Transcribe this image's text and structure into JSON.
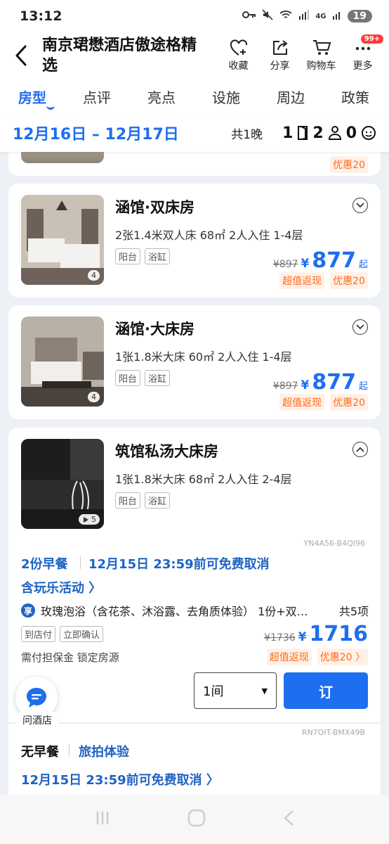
{
  "status": {
    "time": "13:12",
    "network": "4G",
    "battery": "19"
  },
  "header": {
    "title": "南京珺懋酒店傲途格精选",
    "actions": [
      {
        "label": "收藏",
        "icon": "heart-plus-icon"
      },
      {
        "label": "分享",
        "icon": "share-icon"
      },
      {
        "label": "购物车",
        "icon": "cart-icon"
      },
      {
        "label": "更多",
        "icon": "more-icon",
        "badge": "99+"
      }
    ]
  },
  "tabs": [
    "房型",
    "点评",
    "亮点",
    "设施",
    "周边",
    "政策"
  ],
  "datebar": {
    "dates": "12月16日 – 12月17日",
    "nights": "共1晚",
    "rooms": "1",
    "adults": "2",
    "children": "0"
  },
  "partial_card": {
    "promo": "优惠20"
  },
  "rooms": [
    {
      "name": "涵馆·双床房",
      "info": "2张1.4米双人床  68㎡  2人入住  1-4层",
      "tags": [
        "阳台",
        "浴缸"
      ],
      "original_price": "¥897",
      "currency": "¥",
      "price": "877",
      "price_suffix": "起",
      "promos": [
        "超值返现",
        "优惠20"
      ],
      "photo_count": "4"
    },
    {
      "name": "涵馆·大床房",
      "info": "1张1.8米大床  60㎡  2人入住  1-4层",
      "tags": [
        "阳台",
        "浴缸"
      ],
      "original_price": "¥897",
      "currency": "¥",
      "price": "877",
      "price_suffix": "起",
      "promos": [
        "超值返现",
        "优惠20"
      ],
      "photo_count": "4"
    },
    {
      "name": "筑馆私汤大床房",
      "info": "1张1.8米大床  68㎡  2人入住  2-4层",
      "tags": [
        "阳台",
        "浴缸"
      ],
      "photo_count": "5"
    }
  ],
  "package1": {
    "code": "YN4A56-B4QI96",
    "breakfast": "2份早餐",
    "cancel": "12月15日 23:59前可免费取消",
    "activity": "含玩乐活动 〉",
    "xiang_icon": "享",
    "xiang_text": "玫瑰泡浴（含花茶、沐浴露、去角质体验） 1份+双…",
    "xiang_count": "共5项",
    "tags": [
      "到店付",
      "立即确认"
    ],
    "deposit": "需付担保金 锁定房源",
    "original_price": "¥1736",
    "currency": "¥",
    "price": "1716",
    "promos": [
      "超值返现",
      "优惠20 〉"
    ],
    "select_value": "1间",
    "book_label": "订"
  },
  "package2": {
    "code": "RN7OIT-BMX49B",
    "breakfast": "无早餐",
    "extra": "旅拍体验",
    "cancel": "12月15日 23:59前可免费取消 〉"
  },
  "assistant": {
    "label": "问酒店"
  }
}
